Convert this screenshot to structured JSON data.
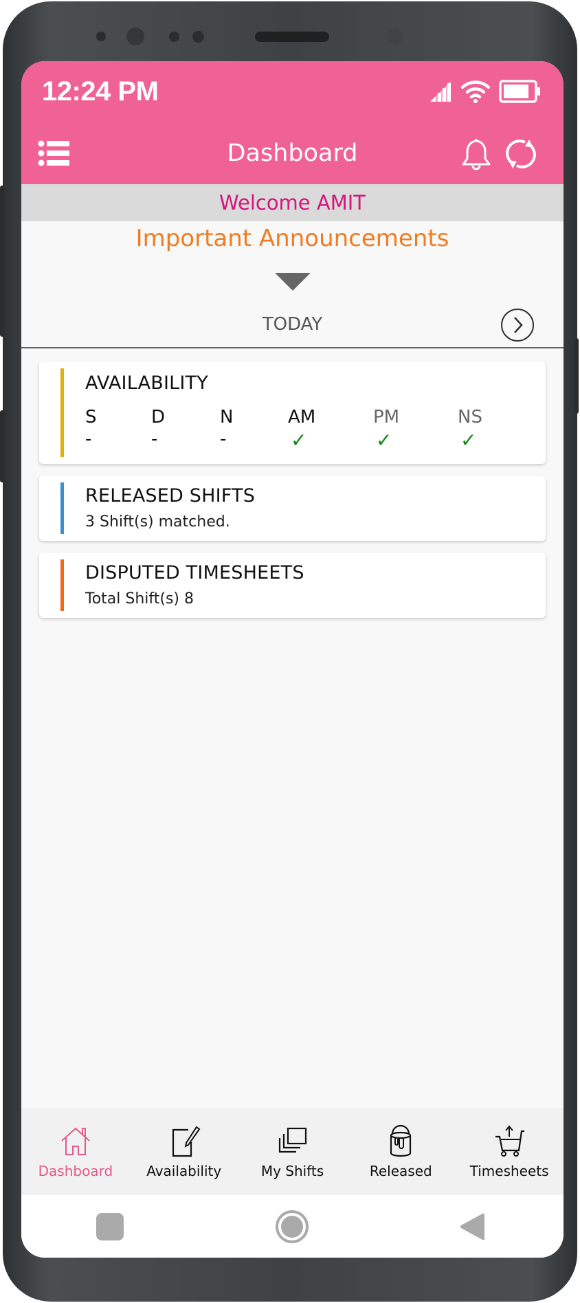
{
  "status_bar": {
    "time": "12:24 PM",
    "icons": [
      "signal-icon",
      "wifi-icon",
      "battery-icon"
    ]
  },
  "app_bar": {
    "title": "Dashboard",
    "left_icon": "menu-list-icon",
    "right_icons": [
      "bell-icon",
      "sync-icon"
    ]
  },
  "colors": {
    "primary": "#ef6293",
    "welcome_text": "#d4157c",
    "announcement_text": "#f07c22",
    "availability_bar": "#e0b010",
    "released_bar": "#3a8fcf",
    "disputed_bar": "#f06a1a",
    "check": "#0b8a14"
  },
  "welcome": "Welcome AMIT",
  "announcements": {
    "title": "Important Announcements",
    "toggle_icon": "triangle-down-icon"
  },
  "date_nav": {
    "label": "TODAY",
    "next_icon": "chevron-right-circle-icon"
  },
  "cards": {
    "availability": {
      "title": "AVAILABILITY",
      "columns": [
        {
          "key": "S",
          "value": "-"
        },
        {
          "key": "D",
          "value": "-"
        },
        {
          "key": "N",
          "value": "-"
        },
        {
          "key": "AM",
          "value": "✓"
        },
        {
          "key": "PM",
          "value": "✓"
        },
        {
          "key": "NS",
          "value": "✓"
        }
      ]
    },
    "released": {
      "title": "RELEASED SHIFTS",
      "subtitle": "3 Shift(s) matched."
    },
    "disputed": {
      "title": "DISPUTED TIMESHEETS",
      "subtitle": "Total Shift(s) 8"
    }
  },
  "bottom_nav": {
    "items": [
      {
        "label": "Dashboard",
        "icon": "home-icon",
        "active": true
      },
      {
        "label": "Availability",
        "icon": "edit-note-icon",
        "active": false
      },
      {
        "label": "My Shifts",
        "icon": "stacked-pages-icon",
        "active": false
      },
      {
        "label": "Released",
        "icon": "paint-bucket-icon",
        "active": false
      },
      {
        "label": "Timesheets",
        "icon": "cart-upload-icon",
        "active": false
      }
    ]
  },
  "system_nav": [
    "recents-button",
    "home-button",
    "back-button"
  ]
}
